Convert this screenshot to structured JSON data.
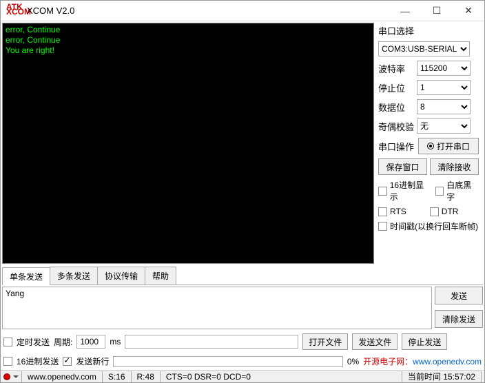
{
  "window": {
    "title": "XCOM V2.0",
    "logo1": "ATK",
    "logo2": "XCOM"
  },
  "terminal": {
    "line1": "error, Continue",
    "line2": "error, Continue",
    "line3": "You are right!"
  },
  "side": {
    "port_label": "串口选择",
    "port_value": "COM3:USB-SERIAL",
    "baud_label": "波特率",
    "baud_value": "115200",
    "stop_label": "停止位",
    "stop_value": "1",
    "data_label": "数据位",
    "data_value": "8",
    "parity_label": "奇偶校验",
    "parity_value": "无",
    "op_label": "串口操作",
    "open_btn": "打开串口",
    "save_btn": "保存窗口",
    "clear_btn": "清除接收",
    "hex_disp": "16进制显示",
    "white_bg": "白底黑字",
    "rts": "RTS",
    "dtr": "DTR",
    "timestamp": "时间戳(以换行回车断帧)"
  },
  "tabs": {
    "t1": "单条发送",
    "t2": "多条发送",
    "t3": "协议传输",
    "t4": "帮助"
  },
  "send": {
    "text": "Yang",
    "send_btn": "发送",
    "clear_btn": "清除发送",
    "timed": "定时发送",
    "period_lbl": "周期:",
    "period_val": "1000",
    "ms": "ms",
    "open_file": "打开文件",
    "send_file": "发送文件",
    "stop_send": "停止发送",
    "hex_send": "16进制发送",
    "send_nl": "发送新行",
    "pct": "0%",
    "link_text": "开源电子网：",
    "link_url": "www.openedv.com"
  },
  "status": {
    "url": "www.openedv.com",
    "s": "S:16",
    "r": "R:48",
    "cts": "CTS=0 DSR=0 DCD=0",
    "time_lbl": "当前时间",
    "time_val": "15:57:02"
  }
}
